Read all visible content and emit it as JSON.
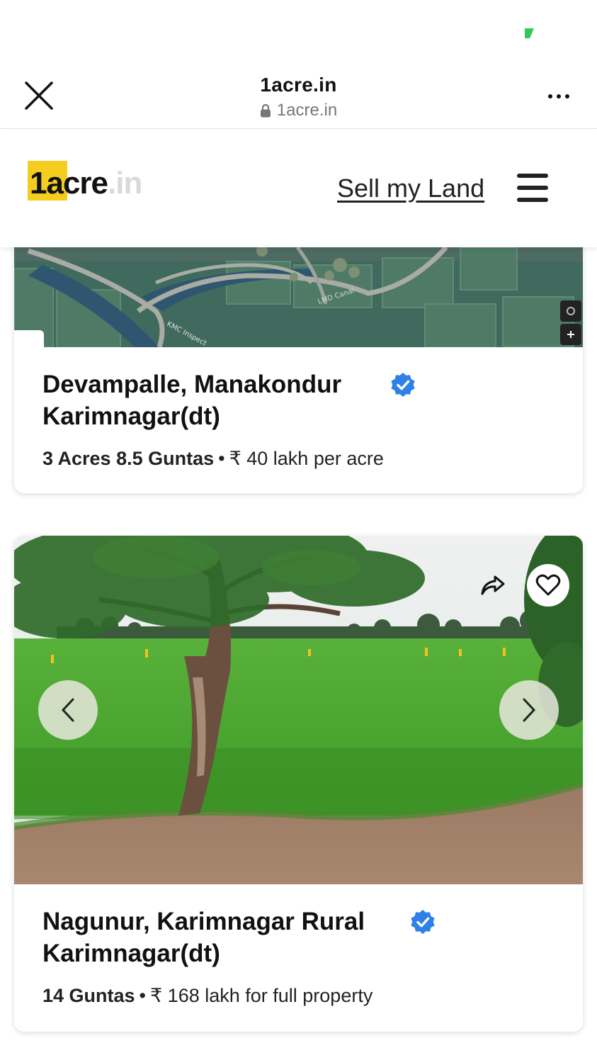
{
  "status_bar": {
    "indicator_color": "#34c759"
  },
  "browser": {
    "title": "1acre.in",
    "url": "1acre.in",
    "icons": {
      "close": "close-icon",
      "lock": "lock-icon",
      "more": "more-icon"
    }
  },
  "header": {
    "logo": {
      "main": "1acre",
      "suffix": ".in",
      "accent": "#f4cd1f"
    },
    "sell_link": "Sell my Land",
    "menu_icon": "hamburger-menu-icon"
  },
  "listings": [
    {
      "title_line1": "Devampalle, Manakondur",
      "title_line2": "Karimnagar(dt)",
      "size": "3 Acres 8.5 Guntas",
      "separator": "•",
      "price": "₹ 40 lakh per acre",
      "verified": true,
      "image": "satellite-map"
    },
    {
      "title_line1": "Nagunur, Karimnagar Rural",
      "title_line2": "Karimnagar(dt)",
      "size": "14 Guntas",
      "separator": "•",
      "price": "₹ 168 lakh for full property",
      "verified": true,
      "image": "farmland-photo"
    }
  ],
  "colors": {
    "verified_badge": "#2f80e8",
    "logo_yellow": "#f4cd1f"
  }
}
